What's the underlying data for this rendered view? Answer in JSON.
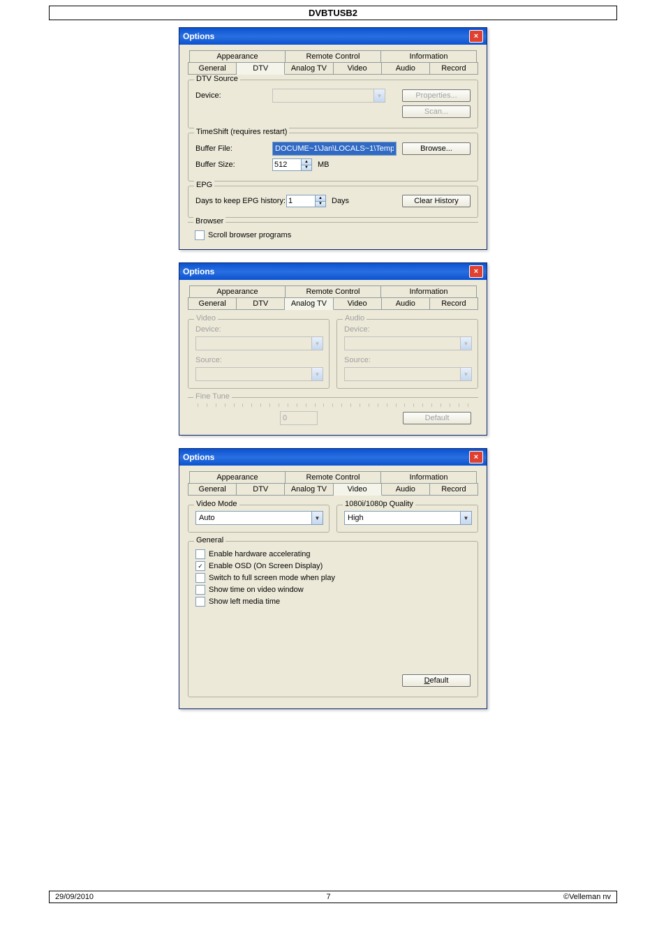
{
  "page": {
    "header_title": "DVBTUSB2",
    "footer_date": "29/09/2010",
    "footer_page": "7",
    "footer_copyright": "©Velleman nv"
  },
  "dialog_common": {
    "title": "Options",
    "close_x": "×",
    "tabs_top": [
      "Appearance",
      "Remote Control",
      "Information"
    ],
    "tabs_bottom": [
      "General",
      "DTV",
      "Analog TV",
      "Video",
      "Audio",
      "Record"
    ],
    "default_btn": "Default"
  },
  "dtv": {
    "source_group": "DTV Source",
    "device_label": "Device:",
    "properties_btn": "Properties...",
    "scan_btn": "Scan...",
    "timeshift_group": "TimeShift (requires restart)",
    "bufferfile_label": "Buffer File:",
    "bufferfile_value": "DOCUME~1\\Jan\\LOCALS~1\\Temp\\",
    "browse_btn": "Browse...",
    "buffersize_label": "Buffer Size:",
    "buffersize_value": "512",
    "buffersize_unit": "MB",
    "epg_group": "EPG",
    "epg_days_label": "Days to keep EPG history:",
    "epg_days_value": "1",
    "epg_days_unit": "Days",
    "clear_history_btn": "Clear History",
    "browser_group": "Browser",
    "scroll_programs": "Scroll browser programs"
  },
  "analog": {
    "video_group": "Video",
    "audio_group": "Audio",
    "device_label": "Device:",
    "source_label": "Source:",
    "finetune_group": "Fine Tune",
    "finetune_value": "0",
    "default_btn": "Default"
  },
  "video": {
    "videomode_group": "Video Mode",
    "videomode_value": "Auto",
    "quality_group": "1080i/1080p Quality",
    "quality_value": "High",
    "general_group": "General",
    "opt_hw_accel": "Enable hardware accelerating",
    "opt_osd": "Enable OSD (On Screen Display)",
    "opt_fullscreen": "Switch to full screen mode when play",
    "opt_showtime": "Show time on video window",
    "opt_leftmedia": "Show left media time",
    "default_btn": "Default"
  }
}
